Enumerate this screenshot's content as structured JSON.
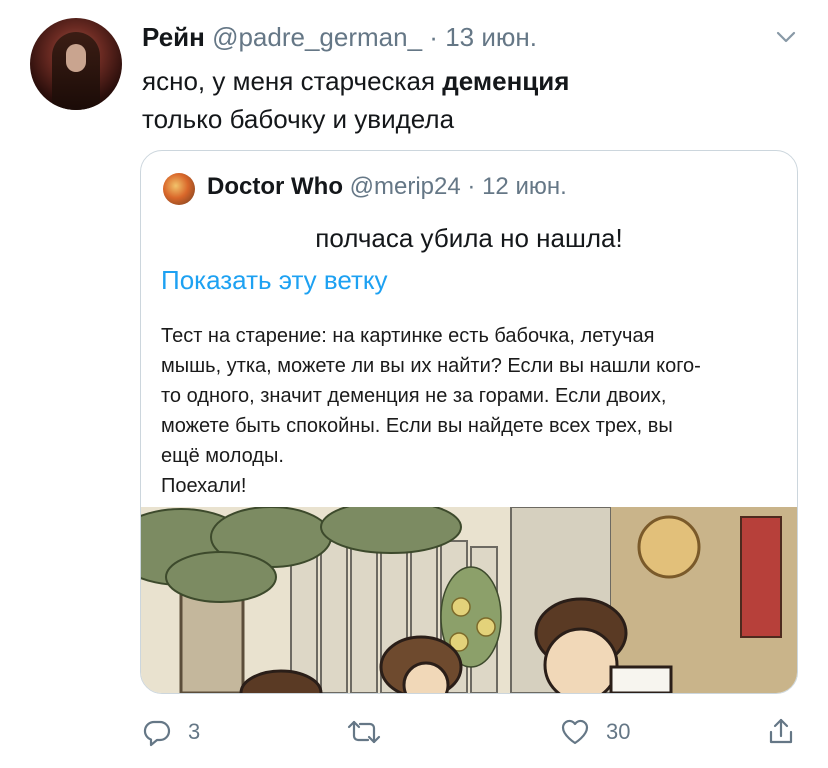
{
  "tweet": {
    "author_name": "Рейн",
    "handle": "@padre_german_",
    "separator": "·",
    "date": "13 июн.",
    "text_line1_prefix": "ясно, у меня старческая ",
    "text_line1_bold": "деменция",
    "text_line2": "только бабочку и увидела",
    "avatar_icon": "avatar-photo",
    "menu_icon": "chevron-down-icon"
  },
  "quoted_tweet": {
    "author_name": "Doctor Who",
    "handle": "@merip24",
    "separator": "·",
    "date": "12 июн.",
    "text": "полчаса убила но нашла!",
    "show_thread": "Показать эту ветку",
    "image_caption_lines": [
      "Тест на старение: на картинке есть бабочка, летучая",
      "мышь, утка, можете ли вы их найти? Если вы нашли кого-",
      "то одного, значит деменция не за горами. Если двоих,",
      "можете быть спокойны. Если вы найдете всех трех, вы",
      "ещё молоды.",
      "Поехали!"
    ]
  },
  "actions": {
    "reply_count": "3",
    "retweet_count": "",
    "like_count": "30",
    "accent_color": "#657786",
    "link_color": "#1da1f2"
  }
}
